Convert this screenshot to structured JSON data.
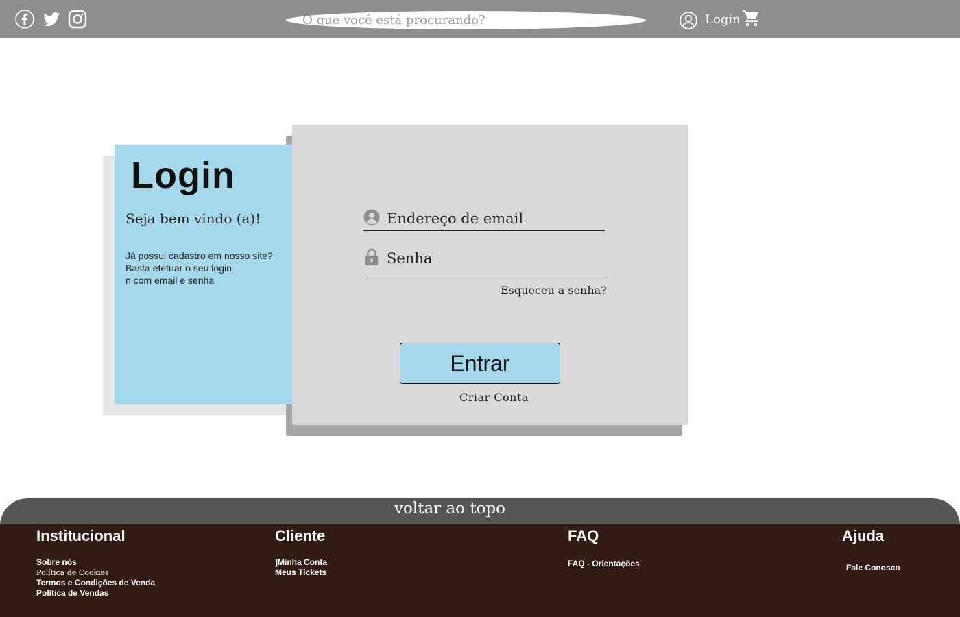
{
  "header": {
    "social_icons": [
      "facebook-icon",
      "twitter-icon",
      "instagram-icon"
    ],
    "search_placeholder": "O que você está procurando?",
    "login_label": "Login",
    "cart_icon": "cart-icon",
    "user_icon": "user-circle-icon"
  },
  "login_panel": {
    "title": "Login",
    "welcome": "Seja bem vindo (a)!",
    "info": "Já possui cadastro em nosso site?\n Basta efetuar o seu login\nn com email e senha"
  },
  "form": {
    "email_placeholder": "Endereço de email",
    "password_placeholder": "Senha",
    "forgot_label": "Esqueceu a senha?",
    "submit_label": "Entrar",
    "create_account_label": "Criar Conta"
  },
  "footer": {
    "back_to_top": "voltar ao topo",
    "columns": [
      {
        "title": "Institucional",
        "links": [
          "Sobre nós",
          "Política de Cookies",
          "Termos e Condições de Venda",
          "Política de Vendas"
        ]
      },
      {
        "title": "Cliente",
        "links": [
          "]Minha Conta",
          "Meus Tickets"
        ]
      },
      {
        "title": "FAQ",
        "links": [
          "FAQ - Orientações"
        ]
      },
      {
        "title": "Ajuda",
        "links": [
          "Fale Conosco"
        ]
      }
    ]
  },
  "colors": {
    "topbar": "#8e8e8e",
    "accent_blue": "#a5d8ea",
    "card_grey": "#d9d9d9",
    "footer_brown": "#331c14",
    "backtop_grey": "#565656"
  }
}
